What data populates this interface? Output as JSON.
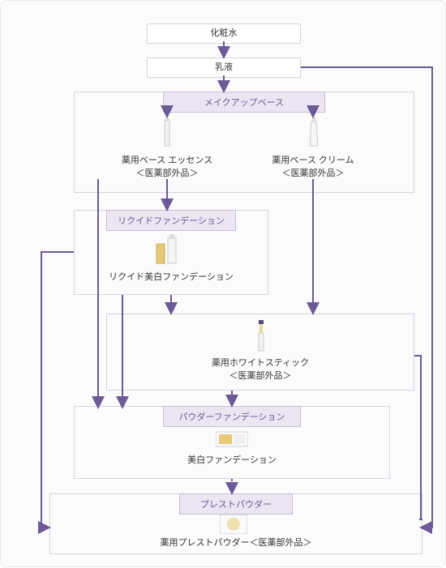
{
  "steps": {
    "lotion": "化粧水",
    "emulsion": "乳液"
  },
  "headers": {
    "makeup_base": "メイクアップベース",
    "liquid_foundation": "リクイドファンデーション",
    "powder_foundation": "パウダーファンデーション",
    "pressed_powder": "プレストパウダー"
  },
  "products": {
    "base_essence_line1": "薬用ベース エッセンス",
    "base_essence_line2": "＜医薬部外品＞",
    "base_cream_line1": "薬用ベース クリーム",
    "base_cream_line2": "＜医薬部外品＞",
    "liquid_whitening": "リクイド美白ファンデーション",
    "white_stick_line1": "薬用ホワイトスティック",
    "white_stick_line2": "＜医薬部外品＞",
    "whitening_foundation": "美白ファンデーション",
    "pressed_powder_product": "薬用プレストパウダー＜医薬部外品＞"
  },
  "colors": {
    "arrow": "#6b5a95",
    "header_bg": "#ece6f3"
  }
}
